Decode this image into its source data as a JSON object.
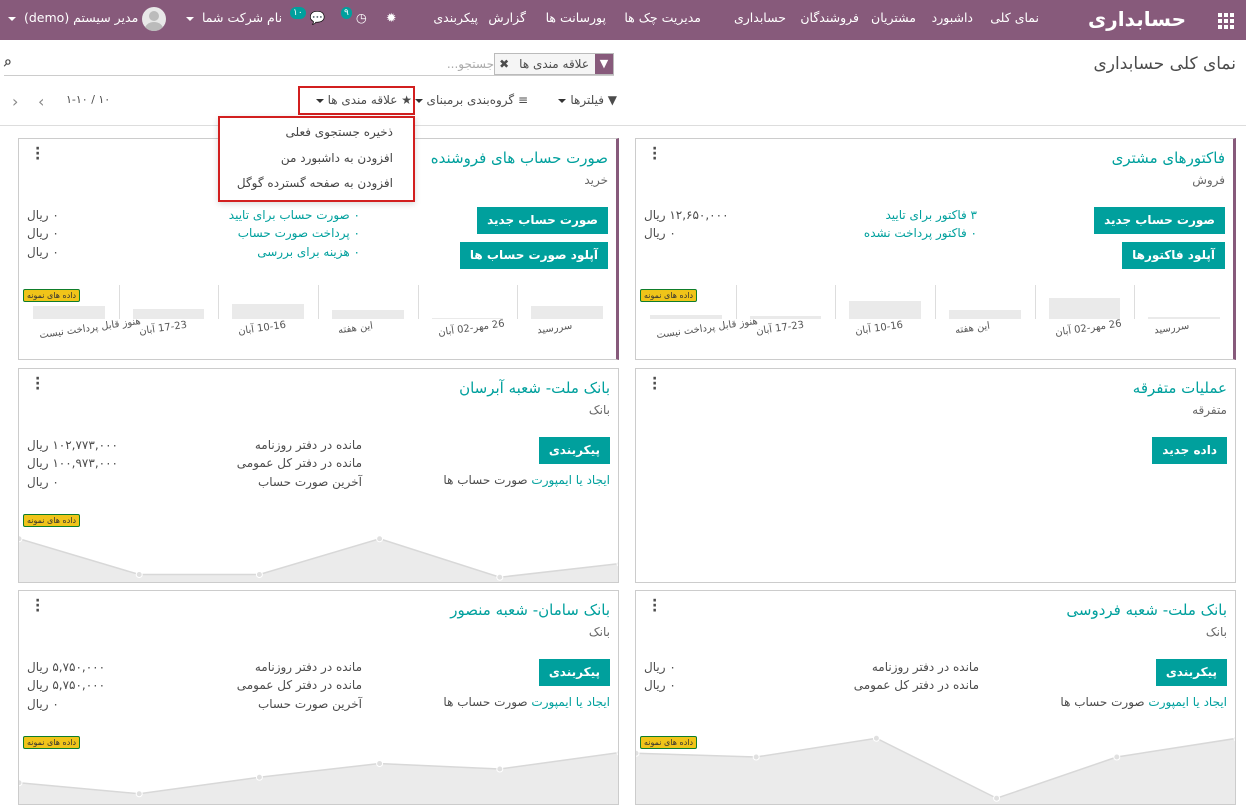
{
  "nav": {
    "brand": "حسابداری",
    "menu": [
      "نمای کلی",
      "داشبورد",
      "مشتریان",
      "فروشندگان",
      "حسابداری",
      "مدیریت چک ها",
      "پورسانت ها",
      "گزارش",
      "پیکربندی"
    ],
    "company": "نام شرکت شما",
    "user": "مدیر سیستم (demo)",
    "msg_count": "۱۰",
    "activity_count": "۹"
  },
  "page": {
    "title": "نمای کلی حسابداری"
  },
  "search": {
    "facet": "علاقه مندی ها",
    "placeholder": "جستجو...",
    "filters": "فیلترها",
    "groupby": "گروه‌بندی برمبنای",
    "favorites": "علاقه مندی ها",
    "pager": "۱-۱۰ / ۱۰"
  },
  "dropdown": {
    "items": [
      "ذخیره جستجوی فعلی",
      "افزودن به داشبورد من",
      "افزودن به صفحه گسترده گوگل"
    ]
  },
  "sample_label": "داده های نمونه",
  "cards": {
    "sales": {
      "title": "فاکتورهای مشتری",
      "subtitle": "فروش",
      "btn1": "صورت حساب جدید",
      "btn2": "آپلود فاکتورها",
      "rows": [
        {
          "label": "۳ فاکتور برای تایید",
          "amount": "۱۲,۶۵۰,۰۰۰ ریال"
        },
        {
          "label": "۰ فاکتور پرداخت نشده",
          "amount": "۰ ریال"
        }
      ],
      "labels": [
        "سررسید",
        "26 مهر-02 آبان",
        "این هفته",
        "10-16 آبان",
        "17-23 آبان",
        "هنوز قابل پرداخت نیست"
      ],
      "bars": [
        0.15,
        0.1,
        0.6,
        0.3,
        0.7,
        0.08
      ]
    },
    "purchase": {
      "title": "صورت حساب های فروشنده",
      "subtitle": "خرید",
      "btn1": "صورت حساب جدید",
      "btn2": "آپلود صورت حساب ها",
      "rows": [
        {
          "label": "۰ صورت حساب برای تایید",
          "amount": "۰ ریال"
        },
        {
          "label": "۰ پرداخت صورت حساب",
          "amount": "۰ ریال"
        },
        {
          "label": "۰ هزینه برای بررسی",
          "amount": "۰ ریال"
        }
      ],
      "labels": [
        "سررسید",
        "26 مهر-02 آبان",
        "این هفته",
        "10-16 آبان",
        "17-23 آبان",
        "هنوز قابل پرداخت نیست"
      ],
      "bars": [
        0.45,
        0.35,
        0.5,
        0.3,
        0.02,
        0.45
      ]
    },
    "misc": {
      "title": "عملیات متفرقه",
      "subtitle": "متفرقه",
      "btn1": "داده جدید"
    },
    "bank1": {
      "title": "بانک ملت- شعبه آبرسان",
      "subtitle": "بانک",
      "btn1": "پیکربندی",
      "create": "ایجاد",
      "or_import": "یا ایمپورت",
      "statements": "صورت حساب ها",
      "rows": [
        {
          "label": "مانده در دفتر روزنامه",
          "amount": "۱۰۲,۷۷۳,۰۰۰ ریال"
        },
        {
          "label": "مانده در دفتر کل عمومی",
          "amount": "۱۰۰,۹۷۳,۰۰۰ ریال"
        },
        {
          "label": "آخرین صورت حساب",
          "amount": "۰ ریال"
        }
      ],
      "line": [
        0.75,
        0.1,
        0.1,
        0.75,
        0.05,
        0.3
      ]
    },
    "bank_ferdowsi": {
      "title": "بانک ملت- شعبه فردوسی",
      "subtitle": "بانک",
      "btn1": "پیکربندی",
      "create": "ایجاد",
      "or_import": "یا ایمپورت",
      "statements": "صورت حساب ها",
      "rows": [
        {
          "label": "مانده در دفتر روزنامه",
          "amount": "۰ ریال"
        },
        {
          "label": "مانده در دفتر کل عمومی",
          "amount": "۰ ریال"
        }
      ],
      "line": [
        0.65,
        0.6,
        0.85,
        0.05,
        0.6,
        0.85
      ]
    },
    "bank_saman": {
      "title": "بانک سامان- شعبه منصور",
      "subtitle": "بانک",
      "btn1": "پیکربندی",
      "create": "ایجاد",
      "or_import": "یا ایمپورت",
      "statements": "صورت حساب ها",
      "rows": [
        {
          "label": "مانده در دفتر روزنامه",
          "amount": "۵,۷۵۰,۰۰۰ ریال"
        },
        {
          "label": "مانده در دفتر کل عمومی",
          "amount": "۵,۷۵۰,۰۰۰ ریال"
        },
        {
          "label": "آخرین صورت حساب",
          "amount": "۰ ریال"
        }
      ],
      "line": [
        0.35,
        0.15,
        0.45,
        0.7,
        0.6,
        0.9
      ]
    }
  }
}
